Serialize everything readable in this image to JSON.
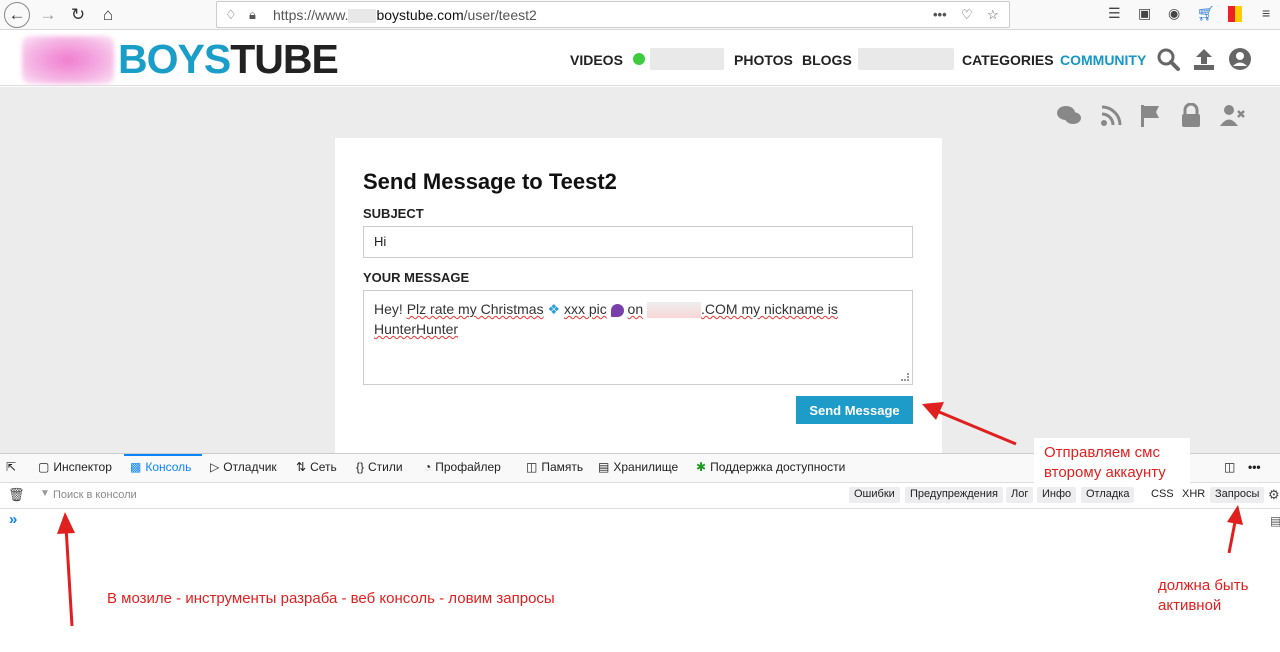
{
  "browser": {
    "url_prefix": "https://www.",
    "url_domain": "boystube.com",
    "url_path": "/user/teest2"
  },
  "site": {
    "logo_part1": "BOYS",
    "logo_part2": "TUBE",
    "nav": [
      {
        "label": "VIDEOS"
      },
      {
        "label": "PHOTOS"
      },
      {
        "label": "BLOGS"
      },
      {
        "label": "CATEGORIES"
      },
      {
        "label": "COMMUNITY"
      }
    ]
  },
  "form": {
    "title": "Send Message to Teest2",
    "subject_label": "SUBJECT",
    "subject_value": "Hi",
    "message_label": "YOUR MESSAGE",
    "message_line1_a": "Hey!",
    "message_line1_b": "Plz rate my Christmas",
    "message_line1_c": "xxx pic",
    "message_line1_d": "on",
    "message_line1_e": ".COM my nickname is",
    "message_line2": "HunterHunter",
    "send_label": "Send Message"
  },
  "devtools": {
    "tabs": [
      "Инспектор",
      "Консоль",
      "Отладчик",
      "Сеть",
      "Стили",
      "Профайлер",
      "Память",
      "Хранилище",
      "Поддержка доступности"
    ],
    "filter_placeholder": "Поиск в консоли",
    "filters": [
      "Ошибки",
      "Предупреждения",
      "Лог",
      "Инфо",
      "Отладка",
      "CSS",
      "XHR",
      "Запросы"
    ],
    "prompt": "»"
  },
  "annotations": {
    "send_note_1": "Отправляем смс",
    "send_note_2": "второму аккаунту",
    "console_note": "В мозиле - инструменты разраба - веб консоль - ловим запросы",
    "requests_note_1": "должна быть",
    "requests_note_2": "активной"
  },
  "colors": {
    "brand_blue": "#1a9ec8",
    "button_blue": "#1d9bc9",
    "annotation_red": "#e01f1f",
    "devtools_active": "#0a84ff"
  }
}
